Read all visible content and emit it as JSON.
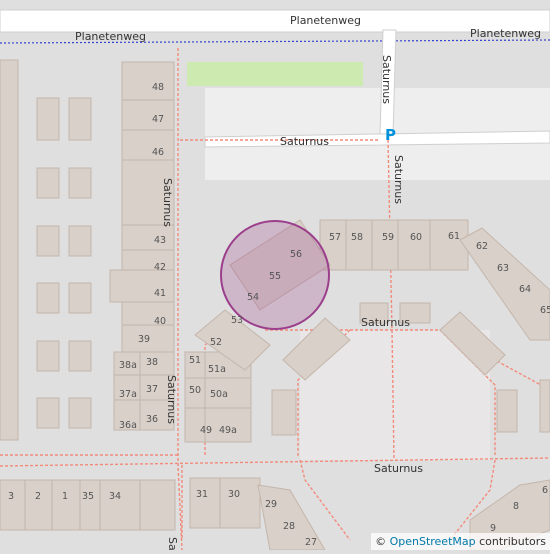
{
  "streets": {
    "planetenweg_top": "Planetenweg",
    "planetenweg_left": "Planetenweg",
    "planetenweg_right": "Planetenweg",
    "saturnus_vertical_top": "Saturnus",
    "saturnus_horizontal_top": "Saturnus",
    "saturnus_right_vertical": "Saturnus",
    "saturnus_left_vertical": "Saturnus",
    "saturnus_center": "Saturnus",
    "saturnus_lower_left": "Saturnus",
    "saturnus_bottom": "Saturnus",
    "saturnus_bottom_edge": "Sa"
  },
  "parking_symbol": "P",
  "house_numbers": {
    "n48": "48",
    "n47": "47",
    "n46": "46",
    "n43": "43",
    "n42": "42",
    "n41": "41",
    "n40": "40",
    "n39": "39",
    "n38a": "38a",
    "n38": "38",
    "n37a": "37a",
    "n37": "37",
    "n36a": "36a",
    "n36": "36",
    "n57": "57",
    "n58": "58",
    "n59": "59",
    "n60": "60",
    "n61": "61",
    "n62": "62",
    "n63": "63",
    "n64": "64",
    "n65": "65",
    "n56": "56",
    "n55": "55",
    "n54": "54",
    "n53": "53",
    "n52": "52",
    "n51": "51",
    "n51a": "51a",
    "n50": "50",
    "n50a": "50a",
    "n49": "49",
    "n49a": "49a",
    "n3": "3",
    "n2": "2",
    "n1": "1",
    "n35": "35",
    "n34": "34",
    "n31": "31",
    "n30": "30",
    "n29": "29",
    "n28": "28",
    "n27": "27",
    "n8": "8",
    "n9": "9",
    "n6": "6"
  },
  "attribution": {
    "prefix": "© ",
    "link": "OpenStreetMap",
    "suffix": " contributors"
  },
  "colors": {
    "background": "#e0dfdf",
    "building": "#d9d0c9",
    "road": "#ffffff",
    "footway": "#f28a7a",
    "grass": "#cdebb0",
    "parking": "#eeeeee",
    "marker": "#9b3f8c",
    "boundary": "#3344cc",
    "parking_symbol": "#0092da"
  }
}
